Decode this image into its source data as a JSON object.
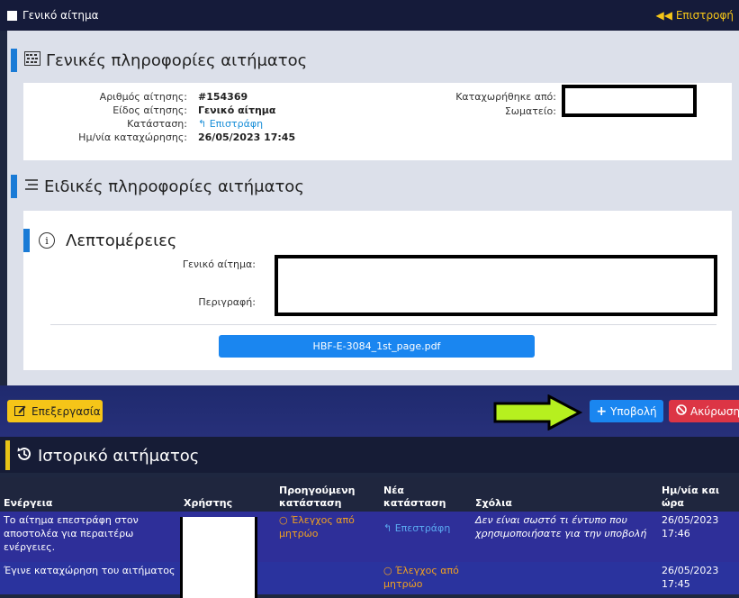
{
  "topbar": {
    "title": "Γενικό αίτημα",
    "back_label": "◀◀ Επιστροφή"
  },
  "general": {
    "heading": "Γενικές πληροφορίες αιτήματος",
    "fields": [
      {
        "label": "Αριθμός αίτησης:",
        "value": "#154369"
      },
      {
        "label": "Είδος αίτησης:",
        "value": "Γενικό αίτημα"
      },
      {
        "label": "Κατάσταση:",
        "value": "↰ Επιστράφη"
      },
      {
        "label": "Ημ/νία καταχώρησης:",
        "value": "26/05/2023 17:45"
      }
    ],
    "right_fields": [
      {
        "label": "Καταχωρήθηκε από:"
      },
      {
        "label": "Σωματείο:"
      }
    ]
  },
  "specific": {
    "heading": "Ειδικές πληροφορίες αιτήματος",
    "details_heading": "Λεπτομέρειες",
    "field_general": "Γενικό αίτημα:",
    "field_description": "Περιγραφή:",
    "attachment": "HBF-E-3084_1st_page.pdf"
  },
  "actions": {
    "edit": "Επεξεργασία",
    "submit": "Υποβολή",
    "cancel": "Ακύρωση"
  },
  "history": {
    "heading": "Ιστορικό αιτήματος",
    "columns": [
      "Ενέργεια",
      "Χρήστης",
      "Προηγούμενη κατάσταση",
      "Νέα κατάσταση",
      "Σχόλια",
      "Ημ/νία και ώρα"
    ],
    "rows": [
      {
        "action": "Το αίτημα επεστράφη στον αποστολέα για περαιτέρω ενέργειες.",
        "prev_state": "○ Έλεγχος από μητρώο",
        "new_state": "↰ Επεστράφη",
        "comment": "Δεν είναι σωστό τι έντυπο που χρησιμοποιήσατε για την υποβολή",
        "datetime": "26/05/2023 17:46"
      },
      {
        "action": "Έγινε καταχώρηση του αιτήματος",
        "prev_state": "",
        "new_state": "○ Έλεγχος από μητρώο",
        "comment": "",
        "datetime": "26/05/2023 17:45"
      }
    ]
  },
  "icons": {
    "title_square": "square-icon",
    "general": "abacus-icon",
    "specific": "list-icon",
    "details": "info-circle-icon",
    "edit": "edit-icon",
    "submit": "plus-icon",
    "cancel": "ban-icon",
    "history": "history-icon",
    "pointer": "arrow-right-icon"
  },
  "colors": {
    "accent_blue": "#1a86f0",
    "accent_yellow": "#f5c518",
    "danger": "#dc3545",
    "pointer_green": "#b6f01f"
  }
}
